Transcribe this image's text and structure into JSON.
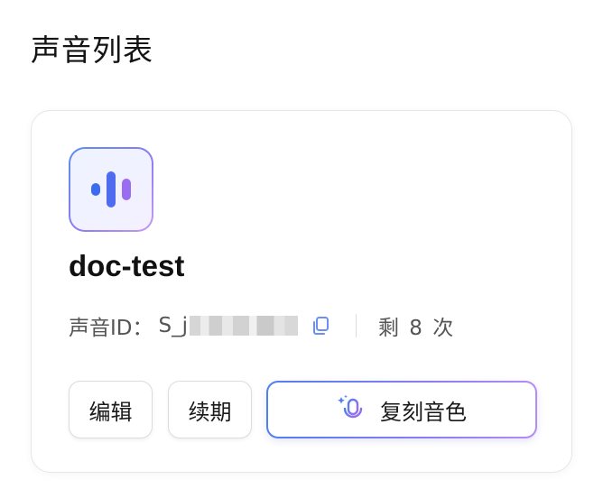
{
  "page": {
    "title": "声音列表"
  },
  "voice_card": {
    "icon": "voice-waveform-icon",
    "name": "doc-test",
    "id_label": "声音ID：",
    "id_value": "S_j",
    "id_redacted": true,
    "copy_icon": "copy-icon",
    "remaining": "剩 8 次",
    "actions": {
      "edit_label": "编辑",
      "renew_label": "续期",
      "clone_label": "复刻音色",
      "clone_icon": "sparkle-mic-icon"
    }
  },
  "colors": {
    "accent_blue": "#3b6cf0",
    "accent_purple": "#9b7cf5",
    "text_primary": "#141414",
    "text_secondary": "#555555",
    "border": "#dcdcdc"
  }
}
